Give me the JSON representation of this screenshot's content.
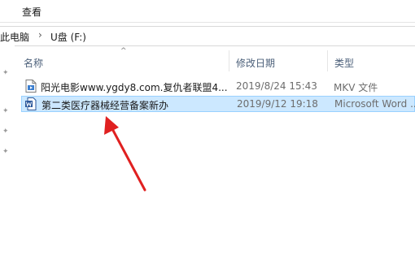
{
  "ribbon": {
    "view_tab": "查看"
  },
  "breadcrumb": {
    "this_pc": "此电脑",
    "drive": "U盘 (F:)"
  },
  "columns": {
    "name": "名称",
    "date": "修改日期",
    "type": "类型"
  },
  "files": [
    {
      "name": "阳光电影www.ygdy8.com.复仇者联盟4...",
      "date": "2019/8/24 15:43",
      "type": "MKV 文件",
      "icon": "video-file-icon"
    },
    {
      "name": "第二类医疗器械经营备案新办",
      "date": "2019/9/12 19:18",
      "type": "Microsoft Word ...",
      "icon": "word-document-icon",
      "selected": true
    }
  ],
  "colors": {
    "selection_bg": "#cce8ff",
    "selection_border": "#99d1ff",
    "header_text": "#4c607a",
    "arrow": "#e02020",
    "word_blue": "#2b579a"
  }
}
